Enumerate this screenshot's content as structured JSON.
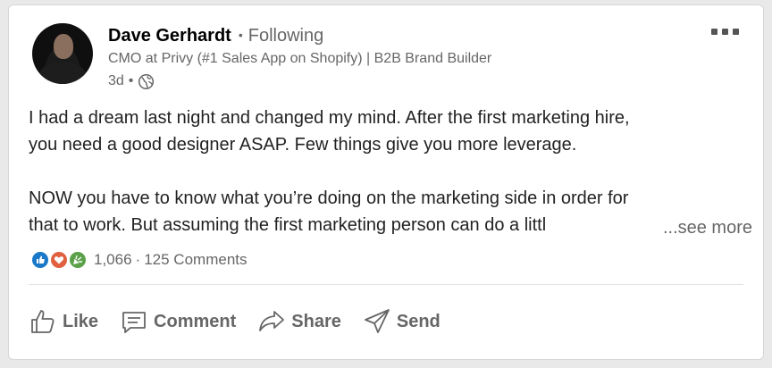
{
  "post": {
    "author": {
      "name": "Dave Gerhardt",
      "separator": "•",
      "follow_status": "Following",
      "headline": "CMO at Privy (#1 Sales App on Shopify) | B2B Brand Builder",
      "time": "3d",
      "time_separator": "•",
      "visibility_icon": "globe-icon"
    },
    "body": {
      "line1": "I had a dream last night and changed my mind. After the first marketing hire,",
      "line2": "you need a good designer ASAP. Few things give you more leverage.",
      "line3": "NOW you have to know what you’re doing on the marketing side in order for",
      "line4": "that to work. But assuming the first marketing person can do a littl",
      "see_more": "...see more"
    },
    "social": {
      "reactions": [
        "like-reaction-icon",
        "love-reaction-icon",
        "celebrate-reaction-icon"
      ],
      "reaction_count": "1,066",
      "separator": "·",
      "comments": "125 Comments"
    },
    "actions": {
      "like": "Like",
      "comment": "Comment",
      "share": "Share",
      "send": "Send"
    }
  }
}
